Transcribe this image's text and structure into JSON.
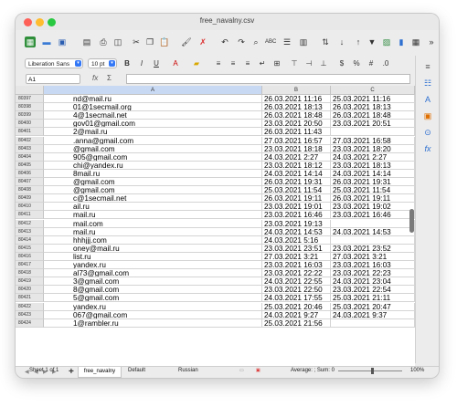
{
  "window": {
    "title": "free_navalny.csv"
  },
  "format_bar": {
    "font_name": "Liberation Sans",
    "font_size": "10 pt"
  },
  "formula_bar": {
    "cell_ref": "A1",
    "fx_label": "fx",
    "sum_label": "Σ",
    "formula_value": ""
  },
  "columns": [
    "A",
    "B",
    "C"
  ],
  "rows": [
    {
      "n": "80397",
      "a": "nd@mail.ru",
      "b": "26.03.2021 11:16",
      "c": "25.03.2021 11:16"
    },
    {
      "n": "80398",
      "a": "01@1secmail.org",
      "b": "26.03.2021 18:13",
      "c": "26.03.2021 18:13"
    },
    {
      "n": "80399",
      "a": "4@1secmail.net",
      "b": "26.03.2021 18:48",
      "c": "26.03.2021 18:48"
    },
    {
      "n": "80400",
      "a": "gov01@gmail.com",
      "b": "23.03.2021 20:50",
      "c": "23.03.2021 20:51"
    },
    {
      "n": "80401",
      "a": "2@mail.ru",
      "b": "26.03.2021 11:43",
      "c": ""
    },
    {
      "n": "80402",
      "a": ".anna@gmail.com",
      "b": "27.03.2021 16:57",
      "c": "27.03.2021 16:58"
    },
    {
      "n": "80403",
      "a": "@gmail.com",
      "b": "23.03.2021 18:18",
      "c": "23.03.2021 18:20"
    },
    {
      "n": "80404",
      "a": "905@gmail.com",
      "b": "24.03.2021 2:27",
      "c": "24.03.2021 2:27"
    },
    {
      "n": "80405",
      "a": "chi@yandex.ru",
      "b": "23.03.2021 18:12",
      "c": "23.03.2021 18:13"
    },
    {
      "n": "80406",
      "a": "8mail.ru",
      "b": "24.03.2021 14:14",
      "c": "24.03.2021 14:14"
    },
    {
      "n": "80407",
      "a": "@gmail.com",
      "b": "26.03.2021 19:31",
      "c": "26.03.2021 19:31"
    },
    {
      "n": "80408",
      "a": "@gmail.com",
      "b": "25.03.2021 11:54",
      "c": "25.03.2021 11:54"
    },
    {
      "n": "80409",
      "a": "c@1secmail.net",
      "b": "26.03.2021 19:11",
      "c": "26.03.2021 19:11"
    },
    {
      "n": "80410",
      "a": "ail.ru",
      "b": "23.03.2021 19:01",
      "c": "23.03.2021 19:02"
    },
    {
      "n": "80411",
      "a": "mail.ru",
      "b": "23.03.2021 16:46",
      "c": "23.03.2021 16:46"
    },
    {
      "n": "80412",
      "a": "mail.com",
      "b": "23.03.2021 19:13",
      "c": ""
    },
    {
      "n": "80413",
      "a": "mail.ru",
      "b": "24.03.2021 14:53",
      "c": "24.03.2021 14:53"
    },
    {
      "n": "80414",
      "a": "hhhjjj.com",
      "b": "24.03.2021 5:16",
      "c": ""
    },
    {
      "n": "80415",
      "a": "oney@mail.ru",
      "b": "23.03.2021 23:51",
      "c": "23.03.2021 23:52"
    },
    {
      "n": "80416",
      "a": "list.ru",
      "b": "27.03.2021 3:21",
      "c": "27.03.2021 3:21"
    },
    {
      "n": "80417",
      "a": "yandex.ru",
      "b": "23.03.2021 16:03",
      "c": "23.03.2021 16:03"
    },
    {
      "n": "80418",
      "a": "al73@gmail.com",
      "b": "23.03.2021 22:22",
      "c": "23.03.2021 22:23"
    },
    {
      "n": "80419",
      "a": "3@gmail.com",
      "b": "24.03.2021 22:55",
      "c": "24.03.2021 23:04"
    },
    {
      "n": "80420",
      "a": "8@gmail.com",
      "b": "23.03.2021 22:50",
      "c": "23.03.2021 22:54"
    },
    {
      "n": "80421",
      "a": "5@gmail.com",
      "b": "24.03.2021 17:55",
      "c": "25.03.2021 21:11"
    },
    {
      "n": "80422",
      "a": "yandex.ru",
      "b": "25.03.2021 20:46",
      "c": "25.03.2021 20:47"
    },
    {
      "n": "80423",
      "a": "067@gmail.com",
      "b": "24.03.2021 9:27",
      "c": "24.03.2021 9:37"
    },
    {
      "n": "80424",
      "a": "1@rambler.ru",
      "b": "25.03.2021 21:56",
      "c": ""
    }
  ],
  "tabs": {
    "add_label": "+",
    "sheet_name": "free_navalny"
  },
  "status": {
    "sheet_info": "Sheet 1 of 1",
    "page_style": "Default",
    "language": "Russian",
    "summary": "Average: ; Sum: 0",
    "zoom": "100%"
  }
}
